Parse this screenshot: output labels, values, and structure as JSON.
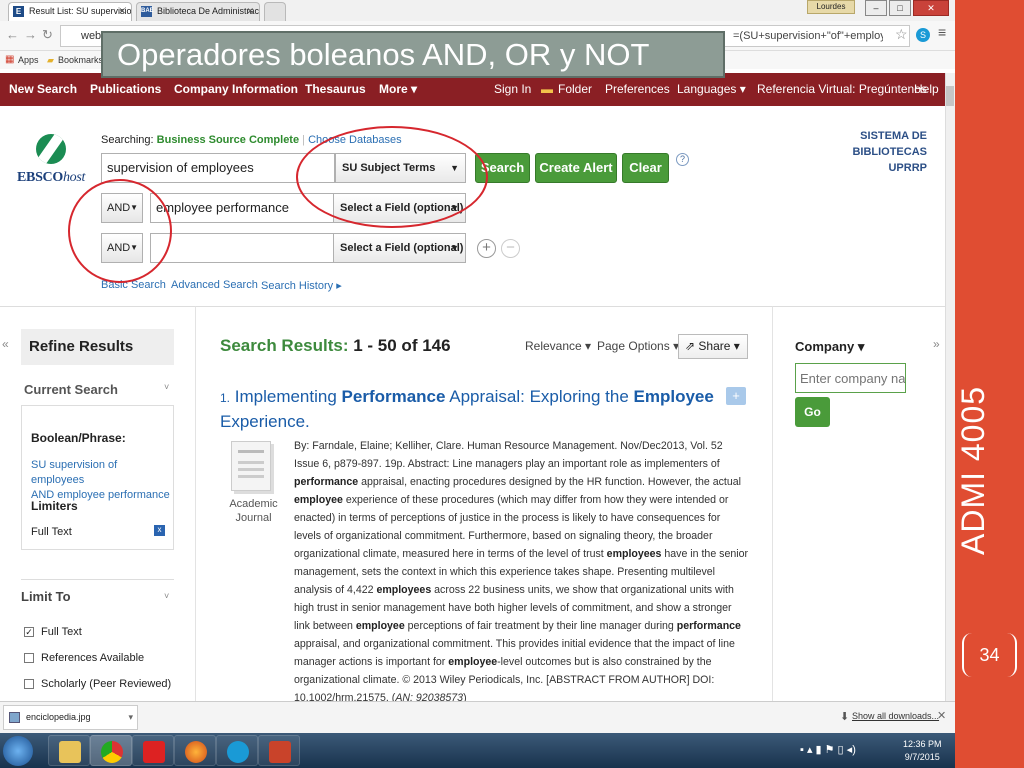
{
  "browser": {
    "tabs": [
      {
        "title": "Result List: SU supervision",
        "icon": "ebsco-favicon",
        "active": true
      },
      {
        "title": "Biblioteca De Administrac",
        "icon": "bae-favicon",
        "active": false
      }
    ],
    "user": "Lourdes",
    "url_start": "web.",
    "url_end": "=(SU+supervision+\"of\"+employ",
    "bookmarks": [
      "Apps",
      "Bookmarks"
    ]
  },
  "slide": {
    "title": "Operadores boleanos AND, OR y NOT",
    "side_label": "ADMI 4005",
    "page_number": "34",
    "accent": "#e04d32"
  },
  "topnav": {
    "left": [
      "New Search",
      "Publications",
      "Company Information",
      "Thesaurus",
      "More"
    ],
    "right": [
      "Sign In",
      "Folder",
      "Preferences",
      "Languages",
      "Referencia Virtual: Pregúntenos",
      "Help"
    ]
  },
  "logo": {
    "name": "EBSCOhost",
    "name_main": "EBSCO",
    "name_suffix": "host"
  },
  "search": {
    "searching_label": "Searching:",
    "database": "Business Source Complete",
    "choose_db": "Choose Databases",
    "rows": [
      {
        "bool": "",
        "text": "supervision of employees",
        "field": "SU Subject Terms"
      },
      {
        "bool": "AND",
        "text": "employee performance",
        "field": "Select a Field (optional)"
      },
      {
        "bool": "AND",
        "text": "",
        "field": "Select a Field (optional)"
      }
    ],
    "search_btn": "Search",
    "alert_btn": "Create Alert",
    "clear_btn": "Clear",
    "help": "?",
    "links": [
      "Basic Search",
      "Advanced Search",
      "Search History"
    ],
    "library": [
      "SISTEMA DE BIBLIOTECAS",
      "UPRRP"
    ]
  },
  "refine": {
    "title": "Refine Results",
    "current_search": "Current Search",
    "boolean_phrase": "Boolean/Phrase:",
    "query": [
      "SU supervision of employees",
      "AND employee performance"
    ],
    "limiters": "Limiters",
    "limiter_value": "Full Text",
    "remove": "x",
    "limit_to": "Limit To",
    "options": [
      {
        "label": "Full Text",
        "checked": true
      },
      {
        "label": "References Available",
        "checked": false
      },
      {
        "label": "Scholarly (Peer Reviewed)",
        "checked": false
      }
    ]
  },
  "results": {
    "heading": "Search Results:",
    "range": "1 - 50 of 146",
    "relevance": "Relevance",
    "page_options": "Page Options",
    "share": "Share",
    "item": {
      "number": "1.",
      "title_parts": [
        "Implementing ",
        "Performance",
        " Appraisal: Exploring the ",
        "Employee",
        " Experience."
      ],
      "type": [
        "Academic",
        "Journal"
      ],
      "abstract": "By: Farndale, Elaine; Kelliher, Clare. Human Resource Management. Nov/Dec2013, Vol. 52 Issue 6, p879-897. 19p. Abstract: Line managers play an important role as implementers of <b>performance</b> appraisal, enacting procedures designed by the HR function. However, the actual <b>employee</b> experience of these procedures (which may differ from how they were intended or enacted) in terms of perceptions of justice in the process is likely to have consequences for levels of organizational commitment. Furthermore, based on signaling theory, the broader organizational climate, measured here in terms of the level of trust <b>employees</b> have in the senior management, sets the context in which this experience takes shape. Presenting multilevel analysis of 4,422 <b>employees</b> across 22 business units, we show that organizational units with high trust in senior management have both higher levels of commitment, and show a stronger link between <b>employee</b> perceptions of fair treatment by their line manager during <b>performance</b> appraisal, and organizational commitment. This provides initial evidence that the impact of line manager actions is important for <b>employee</b>-level outcomes but is also constrained by the organizational climate. © 2013 Wiley Periodicals, Inc. [ABSTRACT FROM AUTHOR] DOI: 10.1002/hrm.21575. (<i>AN: 92038573</i>)"
    }
  },
  "company": {
    "title": "Company",
    "placeholder": "Enter company nan",
    "go": "Go"
  },
  "downloads": {
    "file": "enciclopedia.jpg",
    "show_all": "Show all downloads..."
  },
  "taskbar": {
    "time": "12:36 PM",
    "date": "9/7/2015"
  }
}
